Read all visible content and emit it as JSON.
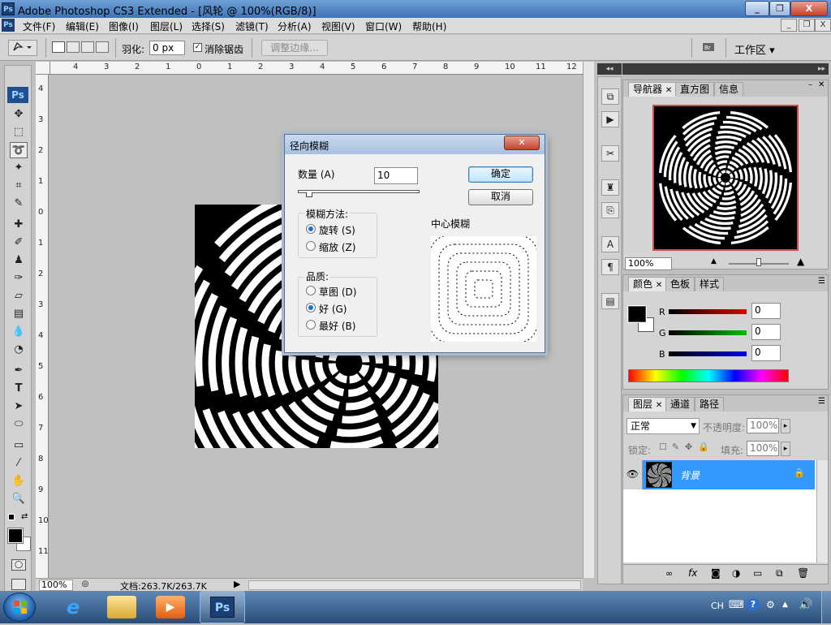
{
  "window": {
    "title": "Adobe Photoshop CS3 Extended - [风轮 @ 100%(RGB/8)]",
    "logo": "Ps",
    "buttons": [
      "_",
      "❐",
      "X"
    ]
  },
  "menu": {
    "items": [
      "文件(F)",
      "编辑(E)",
      "图像(I)",
      "图层(L)",
      "选择(S)",
      "滤镜(T)",
      "分析(A)",
      "视图(V)",
      "窗口(W)",
      "帮助(H)"
    ],
    "doc_buttons": [
      "_",
      "❐",
      "X"
    ]
  },
  "options": {
    "feather_label": "羽化:",
    "feather_value": "0 px",
    "antialias_label": "消除锯齿",
    "refine_edge": "调整边缘...",
    "workspace": "工作区 ▾"
  },
  "ruler": {
    "top": [
      "4",
      "3",
      "2",
      "1",
      "0",
      "1",
      "2",
      "3",
      "4",
      "5",
      "6",
      "7",
      "8",
      "9",
      "10",
      "11",
      "12"
    ],
    "left": [
      "4",
      "3",
      "2",
      "1",
      "0",
      "1",
      "2",
      "3",
      "4",
      "5",
      "6",
      "7",
      "8",
      "9",
      "10",
      "11"
    ]
  },
  "status": {
    "zoom": "100%",
    "doc_label": "文档:263.7K/263.7K"
  },
  "dialog": {
    "title": "径向模糊",
    "amount_label": "数量 (A)",
    "amount_value": "10",
    "ok": "确定",
    "cancel": "取消",
    "method_label": "模糊方法:",
    "method_spin": "旋转 (S)",
    "method_zoom": "缩放 (Z)",
    "quality_label": "品质:",
    "quality_draft": "草图 (D)",
    "quality_good": "好 (G)",
    "quality_best": "最好 (B)",
    "center_label": "中心模糊"
  },
  "navigator": {
    "tabs": [
      "导航器",
      "直方图",
      "信息"
    ],
    "zoom": "100%"
  },
  "color": {
    "tabs": [
      "颜色",
      "色板",
      "样式"
    ],
    "r_label": "R",
    "r_value": "0",
    "g_label": "G",
    "g_value": "0",
    "b_label": "B",
    "b_value": "0"
  },
  "layers": {
    "tabs": [
      "图层",
      "通道",
      "路径"
    ],
    "blend_mode": "正常",
    "opacity_label": "不透明度:",
    "opacity_value": "100%",
    "lock_label": "锁定:",
    "fill_label": "填充:",
    "fill_value": "100%",
    "layer_name": "背景"
  },
  "taskbar": {
    "lang": "CH",
    "ps_label": "Ps"
  },
  "colors": {
    "selection_blue": "#3399ff",
    "nav_frame": "#d84a4a"
  }
}
